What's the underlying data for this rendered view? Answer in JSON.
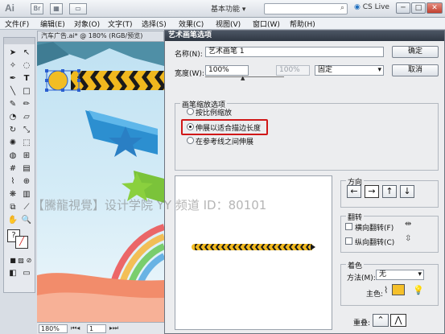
{
  "app": {
    "logo": "Ai",
    "workspace": "基本功能",
    "workspace_arrow": "▾",
    "cs_live": "CS Live",
    "window_buttons": [
      "─",
      "□",
      "✕"
    ]
  },
  "menu": [
    "文件(F)",
    "编辑(E)",
    "对象(O)",
    "文字(T)",
    "选择(S)",
    "效果(C)",
    "视图(V)",
    "窗口(W)",
    "帮助(H)"
  ],
  "document": {
    "tab_title": "汽车广告.ai* @ 180% (RGB/预览)",
    "zoom": "180%",
    "page": "1"
  },
  "dialog": {
    "title": "艺术画笔选项",
    "name_label": "名称(N):",
    "name_value": "艺术画笔 1",
    "width_label": "宽度(W):",
    "width_value": "100%",
    "width_max": "100%",
    "width_mode": "固定",
    "ok": "确定",
    "cancel": "取消",
    "scale_group": "画笔缩放选项",
    "scale_options": [
      "按比例缩放",
      "伸展以适合描边长度",
      "在参考线之间伸展"
    ],
    "scale_selected": 1,
    "direction_group": "方向",
    "direction_buttons": [
      "←",
      "→",
      "↑",
      "↓"
    ],
    "direction_selected": 1,
    "flip_group": "翻转",
    "flip_horizontal": "横向翻转(F)",
    "flip_vertical": "纵向翻转(C)",
    "color_group": "着色",
    "method_label": "方法(M):",
    "method_value": "无",
    "key_color_label": "主色:",
    "key_color": "#f5c02a",
    "overlap_label": "重叠:",
    "highlight_color": "#d01818"
  },
  "watermark": "【騰龍視覺】设计学院 YY 频道 ID：80101"
}
